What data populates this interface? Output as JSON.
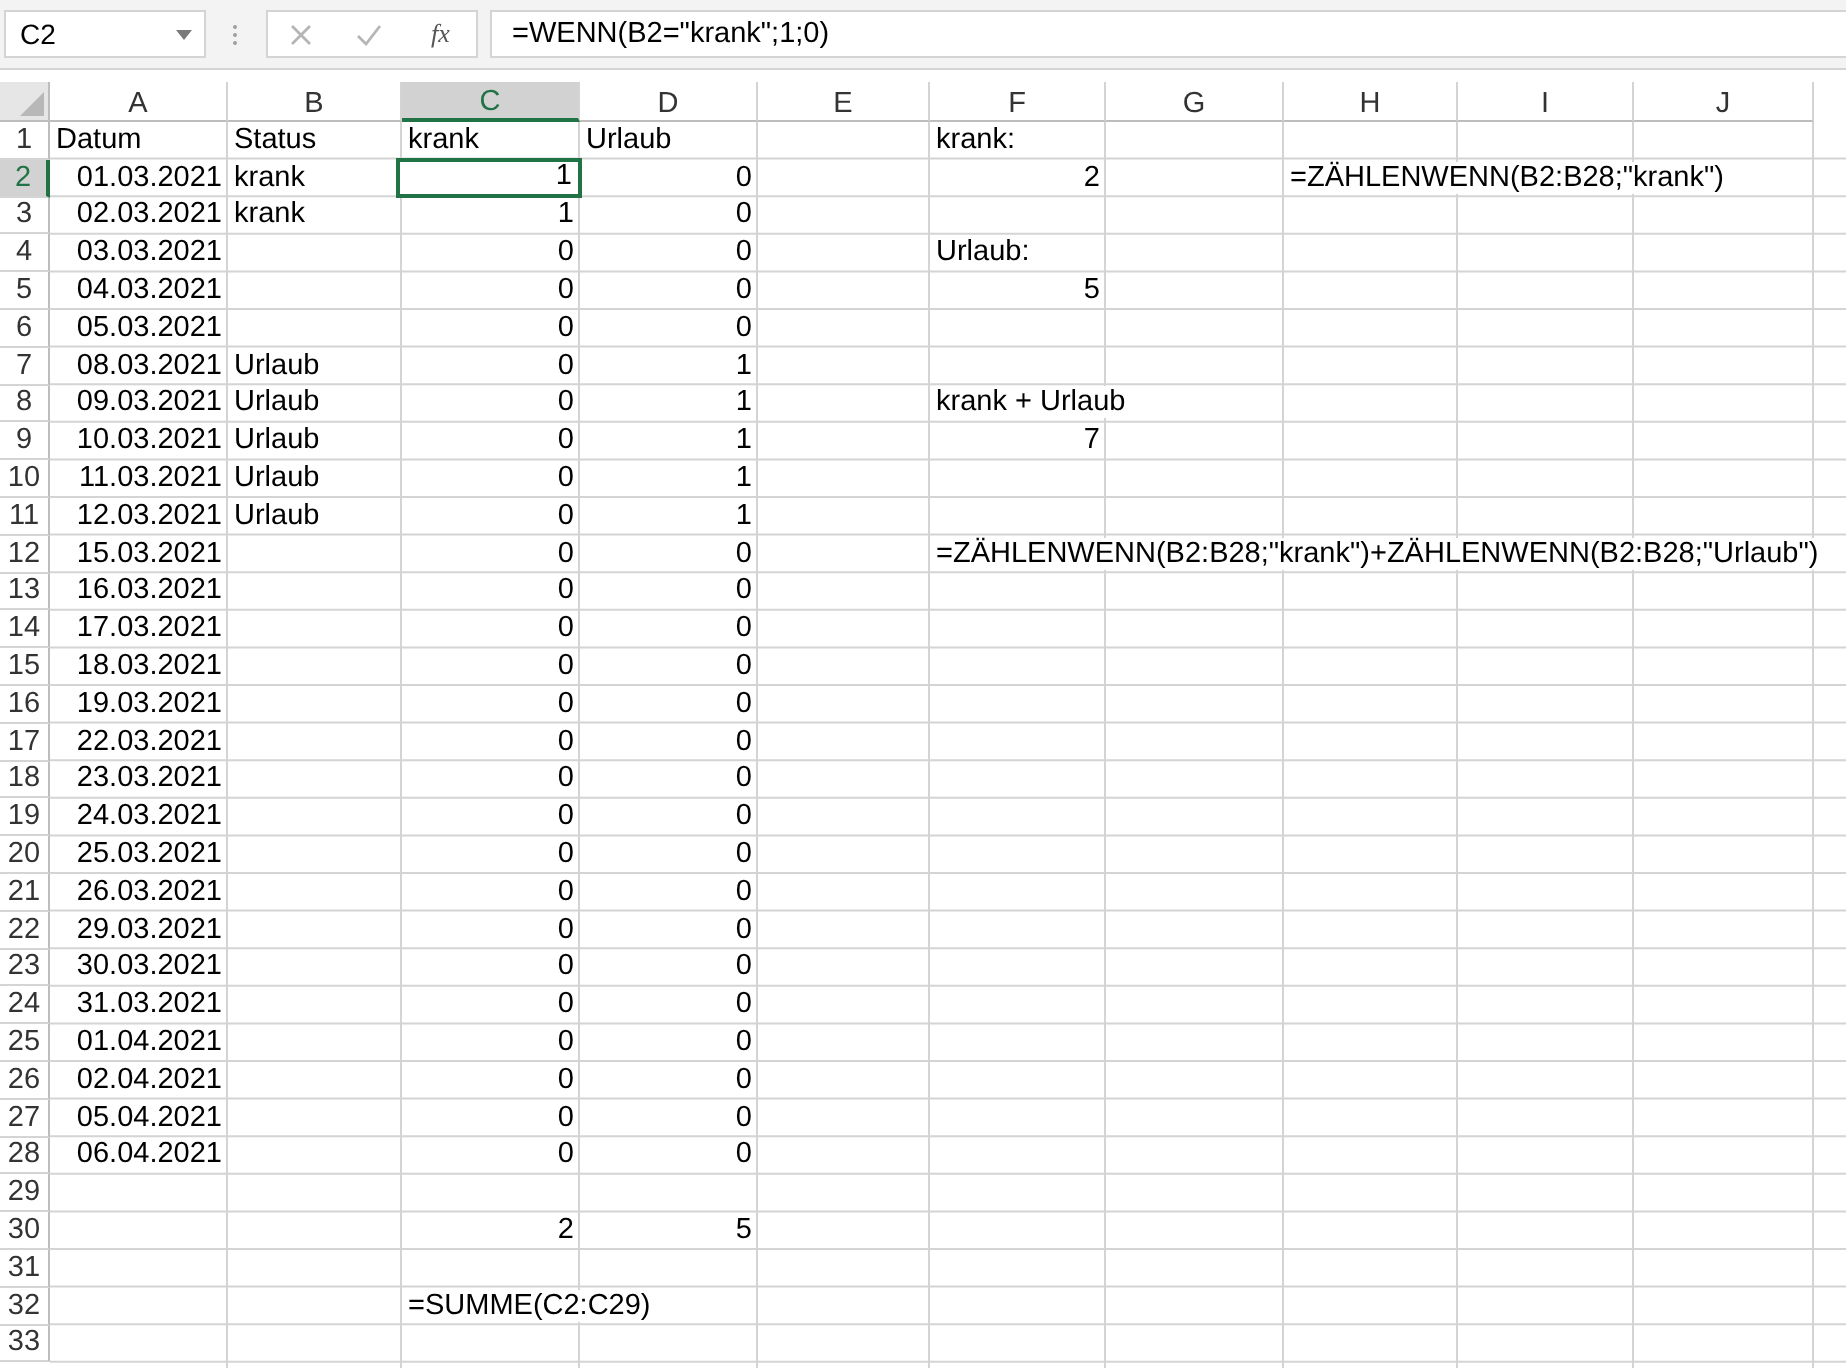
{
  "name_box": "C2",
  "function_button": "fx",
  "formula": "=WENN(B2=\"krank\";1;0)",
  "columns": [
    {
      "label": "A",
      "selected": false
    },
    {
      "label": "B",
      "selected": false
    },
    {
      "label": "C",
      "selected": true
    },
    {
      "label": "D",
      "selected": false
    },
    {
      "label": "E",
      "selected": false
    },
    {
      "label": "F",
      "selected": false
    },
    {
      "label": "G",
      "selected": false
    },
    {
      "label": "H",
      "selected": false
    },
    {
      "label": "I",
      "selected": false
    },
    {
      "label": "J",
      "selected": false
    }
  ],
  "rows": [
    {
      "label": "1",
      "selected": false,
      "cells": {
        "A": {
          "text": "Datum",
          "kind": "text"
        },
        "B": {
          "text": "Status",
          "kind": "text"
        },
        "C": {
          "text": "krank",
          "kind": "text"
        },
        "D": {
          "text": "Urlaub",
          "kind": "text"
        },
        "F": {
          "text": "krank:",
          "kind": "text"
        }
      }
    },
    {
      "label": "2",
      "selected": true,
      "cells": {
        "A": {
          "text": "01.03.2021",
          "kind": "number"
        },
        "B": {
          "text": "krank",
          "kind": "text"
        },
        "C": {
          "text": "1",
          "kind": "number"
        },
        "D": {
          "text": "0",
          "kind": "number"
        },
        "F": {
          "text": "2",
          "kind": "number"
        },
        "H": {
          "text": "=ZÄHLENWENN(B2:B28;\"krank\")",
          "kind": "text"
        }
      }
    },
    {
      "label": "3",
      "selected": false,
      "cells": {
        "A": {
          "text": "02.03.2021",
          "kind": "number"
        },
        "B": {
          "text": "krank",
          "kind": "text"
        },
        "C": {
          "text": "1",
          "kind": "number"
        },
        "D": {
          "text": "0",
          "kind": "number"
        }
      }
    },
    {
      "label": "4",
      "selected": false,
      "cells": {
        "A": {
          "text": "03.03.2021",
          "kind": "number"
        },
        "C": {
          "text": "0",
          "kind": "number"
        },
        "D": {
          "text": "0",
          "kind": "number"
        },
        "F": {
          "text": "Urlaub:",
          "kind": "text"
        }
      }
    },
    {
      "label": "5",
      "selected": false,
      "cells": {
        "A": {
          "text": "04.03.2021",
          "kind": "number"
        },
        "C": {
          "text": "0",
          "kind": "number"
        },
        "D": {
          "text": "0",
          "kind": "number"
        },
        "F": {
          "text": "5",
          "kind": "number"
        }
      }
    },
    {
      "label": "6",
      "selected": false,
      "cells": {
        "A": {
          "text": "05.03.2021",
          "kind": "number"
        },
        "C": {
          "text": "0",
          "kind": "number"
        },
        "D": {
          "text": "0",
          "kind": "number"
        }
      }
    },
    {
      "label": "7",
      "selected": false,
      "cells": {
        "A": {
          "text": "08.03.2021",
          "kind": "number"
        },
        "B": {
          "text": "Urlaub",
          "kind": "text"
        },
        "C": {
          "text": "0",
          "kind": "number"
        },
        "D": {
          "text": "1",
          "kind": "number"
        }
      }
    },
    {
      "label": "8",
      "selected": false,
      "cells": {
        "A": {
          "text": "09.03.2021",
          "kind": "number"
        },
        "B": {
          "text": "Urlaub",
          "kind": "text"
        },
        "C": {
          "text": "0",
          "kind": "number"
        },
        "D": {
          "text": "1",
          "kind": "number"
        },
        "F": {
          "text": "krank + Urlaub",
          "kind": "text"
        }
      }
    },
    {
      "label": "9",
      "selected": false,
      "cells": {
        "A": {
          "text": "10.03.2021",
          "kind": "number"
        },
        "B": {
          "text": "Urlaub",
          "kind": "text"
        },
        "C": {
          "text": "0",
          "kind": "number"
        },
        "D": {
          "text": "1",
          "kind": "number"
        },
        "F": {
          "text": "7",
          "kind": "number"
        }
      }
    },
    {
      "label": "10",
      "selected": false,
      "cells": {
        "A": {
          "text": "11.03.2021",
          "kind": "number"
        },
        "B": {
          "text": "Urlaub",
          "kind": "text"
        },
        "C": {
          "text": "0",
          "kind": "number"
        },
        "D": {
          "text": "1",
          "kind": "number"
        }
      }
    },
    {
      "label": "11",
      "selected": false,
      "cells": {
        "A": {
          "text": "12.03.2021",
          "kind": "number"
        },
        "B": {
          "text": "Urlaub",
          "kind": "text"
        },
        "C": {
          "text": "0",
          "kind": "number"
        },
        "D": {
          "text": "1",
          "kind": "number"
        }
      }
    },
    {
      "label": "12",
      "selected": false,
      "cells": {
        "A": {
          "text": "15.03.2021",
          "kind": "number"
        },
        "C": {
          "text": "0",
          "kind": "number"
        },
        "D": {
          "text": "0",
          "kind": "number"
        },
        "F": {
          "text": "=ZÄHLENWENN(B2:B28;\"krank\")+ZÄHLENWENN(B2:B28;\"Urlaub\")",
          "kind": "text"
        }
      }
    },
    {
      "label": "13",
      "selected": false,
      "cells": {
        "A": {
          "text": "16.03.2021",
          "kind": "number"
        },
        "C": {
          "text": "0",
          "kind": "number"
        },
        "D": {
          "text": "0",
          "kind": "number"
        }
      }
    },
    {
      "label": "14",
      "selected": false,
      "cells": {
        "A": {
          "text": "17.03.2021",
          "kind": "number"
        },
        "C": {
          "text": "0",
          "kind": "number"
        },
        "D": {
          "text": "0",
          "kind": "number"
        }
      }
    },
    {
      "label": "15",
      "selected": false,
      "cells": {
        "A": {
          "text": "18.03.2021",
          "kind": "number"
        },
        "C": {
          "text": "0",
          "kind": "number"
        },
        "D": {
          "text": "0",
          "kind": "number"
        }
      }
    },
    {
      "label": "16",
      "selected": false,
      "cells": {
        "A": {
          "text": "19.03.2021",
          "kind": "number"
        },
        "C": {
          "text": "0",
          "kind": "number"
        },
        "D": {
          "text": "0",
          "kind": "number"
        }
      }
    },
    {
      "label": "17",
      "selected": false,
      "cells": {
        "A": {
          "text": "22.03.2021",
          "kind": "number"
        },
        "C": {
          "text": "0",
          "kind": "number"
        },
        "D": {
          "text": "0",
          "kind": "number"
        }
      }
    },
    {
      "label": "18",
      "selected": false,
      "cells": {
        "A": {
          "text": "23.03.2021",
          "kind": "number"
        },
        "C": {
          "text": "0",
          "kind": "number"
        },
        "D": {
          "text": "0",
          "kind": "number"
        }
      }
    },
    {
      "label": "19",
      "selected": false,
      "cells": {
        "A": {
          "text": "24.03.2021",
          "kind": "number"
        },
        "C": {
          "text": "0",
          "kind": "number"
        },
        "D": {
          "text": "0",
          "kind": "number"
        }
      }
    },
    {
      "label": "20",
      "selected": false,
      "cells": {
        "A": {
          "text": "25.03.2021",
          "kind": "number"
        },
        "C": {
          "text": "0",
          "kind": "number"
        },
        "D": {
          "text": "0",
          "kind": "number"
        }
      }
    },
    {
      "label": "21",
      "selected": false,
      "cells": {
        "A": {
          "text": "26.03.2021",
          "kind": "number"
        },
        "C": {
          "text": "0",
          "kind": "number"
        },
        "D": {
          "text": "0",
          "kind": "number"
        }
      }
    },
    {
      "label": "22",
      "selected": false,
      "cells": {
        "A": {
          "text": "29.03.2021",
          "kind": "number"
        },
        "C": {
          "text": "0",
          "kind": "number"
        },
        "D": {
          "text": "0",
          "kind": "number"
        }
      }
    },
    {
      "label": "23",
      "selected": false,
      "cells": {
        "A": {
          "text": "30.03.2021",
          "kind": "number"
        },
        "C": {
          "text": "0",
          "kind": "number"
        },
        "D": {
          "text": "0",
          "kind": "number"
        }
      }
    },
    {
      "label": "24",
      "selected": false,
      "cells": {
        "A": {
          "text": "31.03.2021",
          "kind": "number"
        },
        "C": {
          "text": "0",
          "kind": "number"
        },
        "D": {
          "text": "0",
          "kind": "number"
        }
      }
    },
    {
      "label": "25",
      "selected": false,
      "cells": {
        "A": {
          "text": "01.04.2021",
          "kind": "number"
        },
        "C": {
          "text": "0",
          "kind": "number"
        },
        "D": {
          "text": "0",
          "kind": "number"
        }
      }
    },
    {
      "label": "26",
      "selected": false,
      "cells": {
        "A": {
          "text": "02.04.2021",
          "kind": "number"
        },
        "C": {
          "text": "0",
          "kind": "number"
        },
        "D": {
          "text": "0",
          "kind": "number"
        }
      }
    },
    {
      "label": "27",
      "selected": false,
      "cells": {
        "A": {
          "text": "05.04.2021",
          "kind": "number"
        },
        "C": {
          "text": "0",
          "kind": "number"
        },
        "D": {
          "text": "0",
          "kind": "number"
        }
      }
    },
    {
      "label": "28",
      "selected": false,
      "cells": {
        "A": {
          "text": "06.04.2021",
          "kind": "number"
        },
        "C": {
          "text": "0",
          "kind": "number"
        },
        "D": {
          "text": "0",
          "kind": "number"
        }
      }
    },
    {
      "label": "29",
      "selected": false,
      "cells": {}
    },
    {
      "label": "30",
      "selected": false,
      "cells": {
        "C": {
          "text": "2",
          "kind": "number"
        },
        "D": {
          "text": "5",
          "kind": "number"
        }
      }
    },
    {
      "label": "31",
      "selected": false,
      "cells": {}
    },
    {
      "label": "32",
      "selected": false,
      "cells": {
        "C": {
          "text": "=SUMME(C2:C29)",
          "kind": "text"
        }
      }
    },
    {
      "label": "33",
      "selected": false,
      "cells": {}
    }
  ]
}
